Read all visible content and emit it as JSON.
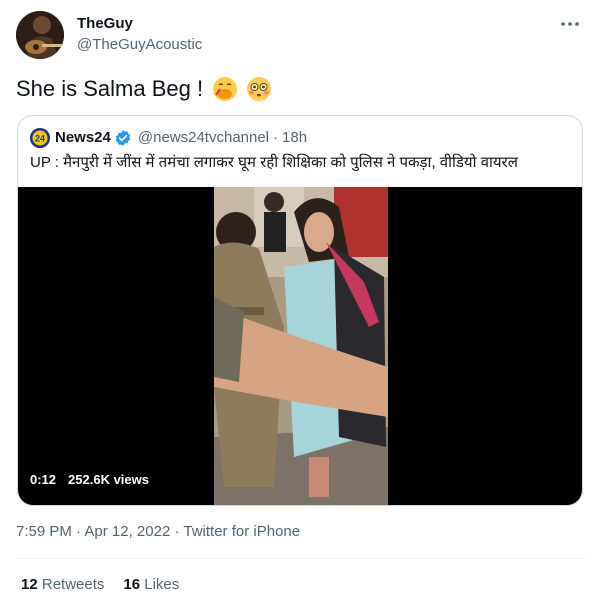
{
  "author": {
    "display_name": "TheGuy",
    "handle": "@TheGuyAcoustic"
  },
  "tweet": {
    "text": "She is Salma Beg !",
    "emojis": [
      "face-with-hand-over-mouth",
      "flushed-face"
    ]
  },
  "quoted": {
    "name": "News24",
    "verified": true,
    "handle": "@news24tvchannel",
    "separator": "·",
    "time_ago": "18h",
    "text": "UP : मैनपुरी में जींस में तमंचा लगाकर घूम रही शिक्षिका को पुलिस ने पकड़ा, वीडियो वायरल",
    "video": {
      "duration": "0:12",
      "views": "252.6K views"
    }
  },
  "meta": {
    "time": "7:59 PM",
    "date": "Apr 12, 2022",
    "source": "Twitter for iPhone",
    "sep": "·"
  },
  "stats": {
    "retweets_count": "12",
    "retweets_label": "Retweets",
    "likes_count": "16",
    "likes_label": "Likes"
  },
  "colors": {
    "text": "#0f1419",
    "secondary": "#536471",
    "border": "#cfd9de",
    "verified": "#1d9bf0"
  },
  "icons": {
    "more": "more-horizontal-icon",
    "verified": "verified-badge-icon"
  }
}
